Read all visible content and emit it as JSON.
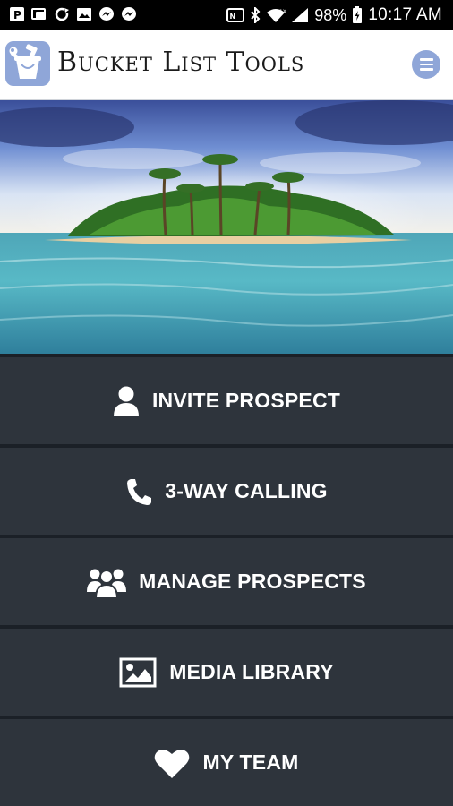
{
  "status_bar": {
    "battery": "98%",
    "time": "10:17 AM",
    "network_badge": "1X",
    "icons": [
      "parking-notification-icon",
      "photo-notification-icon",
      "sync-notification-icon",
      "gallery-notification-icon",
      "messenger-icon",
      "messenger-icon",
      "nfc-icon",
      "bluetooth-icon",
      "wifi-icon",
      "signal-icon",
      "battery-icon"
    ]
  },
  "header": {
    "brand": "Bucket List Tools",
    "logo_icon": "bucket-tools-logo-icon",
    "menu_icon": "hamburger-menu-icon",
    "accent_color": "#8fa6d8"
  },
  "hero": {
    "image": "tropical-island-hero-image"
  },
  "menu": {
    "background": "#2e343c",
    "items": [
      {
        "label": "INVITE PROSPECT",
        "icon": "user-icon"
      },
      {
        "label": "3-WAY CALLING",
        "icon": "phone-icon"
      },
      {
        "label": "MANAGE PROSPECTS",
        "icon": "group-icon"
      },
      {
        "label": "MEDIA LIBRARY",
        "icon": "image-icon"
      },
      {
        "label": "MY TEAM",
        "icon": "heart-icon"
      }
    ]
  }
}
